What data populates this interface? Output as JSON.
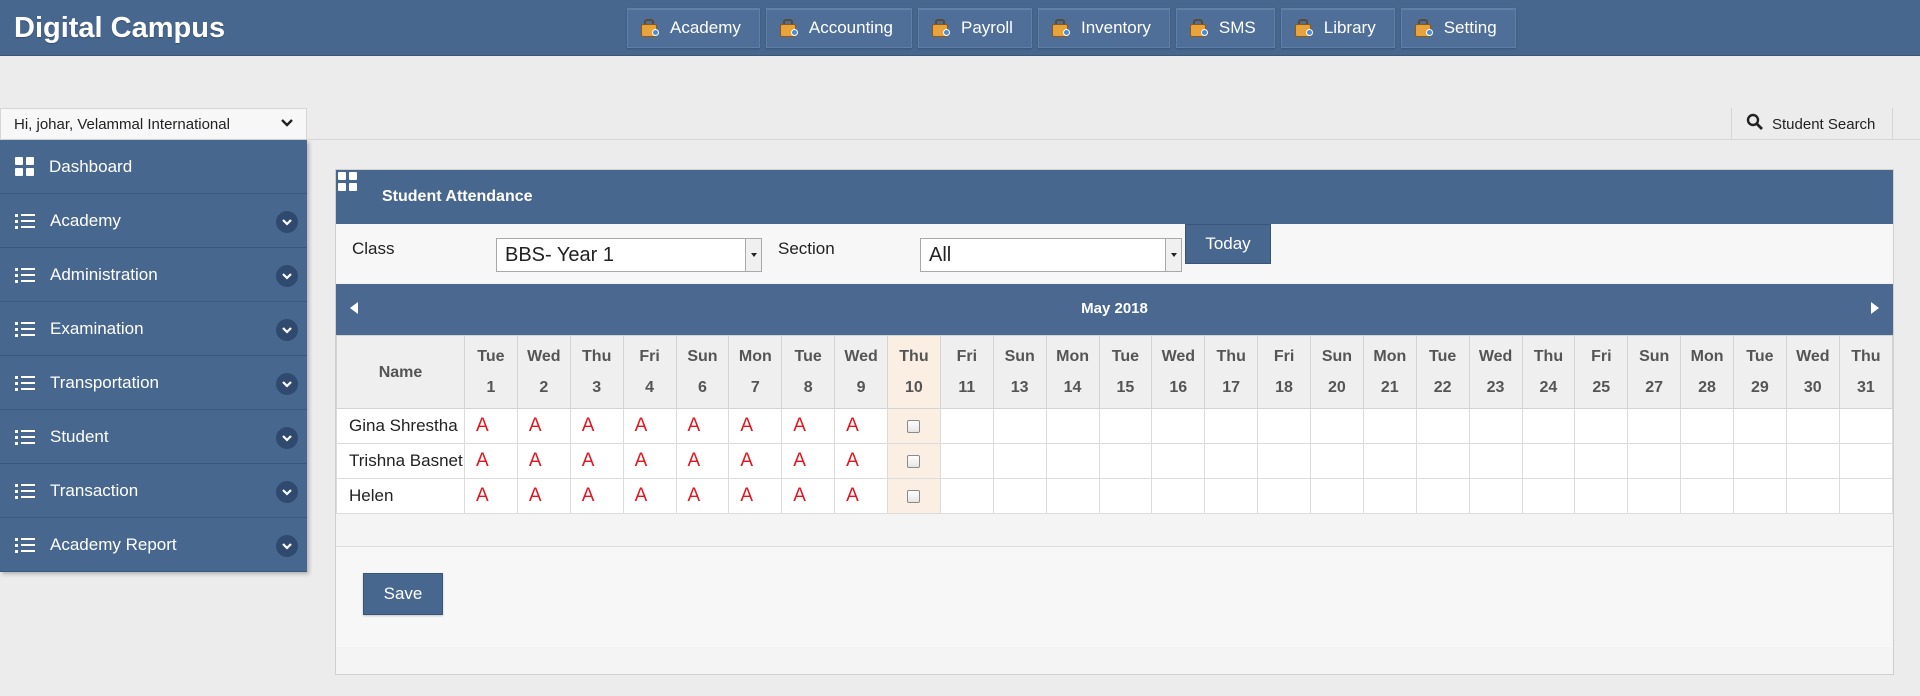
{
  "app": {
    "title": "Digital Campus"
  },
  "topnav": [
    "Academy",
    "Accounting",
    "Payroll",
    "Inventory",
    "SMS",
    "Library",
    "Setting"
  ],
  "user": {
    "greeting": "Hi, johar, Velammal International"
  },
  "sidebar": {
    "items": [
      {
        "label": "Dashboard",
        "icon": "dashboard-grid-icon"
      },
      {
        "label": "Academy",
        "icon": "list-icon"
      },
      {
        "label": "Administration",
        "icon": "list-icon"
      },
      {
        "label": "Examination",
        "icon": "list-icon"
      },
      {
        "label": "Transportation",
        "icon": "list-icon"
      },
      {
        "label": "Student",
        "icon": "list-icon"
      },
      {
        "label": "Transaction",
        "icon": "list-icon"
      },
      {
        "label": "Academy Report",
        "icon": "list-icon"
      }
    ]
  },
  "search": {
    "label": "Student Search"
  },
  "panel": {
    "title": "Student Attendance"
  },
  "filters": {
    "class_label": "Class",
    "class_value": "BBS- Year 1",
    "section_label": "Section",
    "section_value": "All",
    "today_label": "Today"
  },
  "calendar": {
    "month": "May 2018",
    "name_header": "Name",
    "days": [
      {
        "dow": "Tue",
        "day": "1"
      },
      {
        "dow": "Wed",
        "day": "2"
      },
      {
        "dow": "Thu",
        "day": "3"
      },
      {
        "dow": "Fri",
        "day": "4"
      },
      {
        "dow": "Sun",
        "day": "6"
      },
      {
        "dow": "Mon",
        "day": "7"
      },
      {
        "dow": "Tue",
        "day": "8"
      },
      {
        "dow": "Wed",
        "day": "9"
      },
      {
        "dow": "Thu",
        "day": "10"
      },
      {
        "dow": "Fri",
        "day": "11"
      },
      {
        "dow": "Sun",
        "day": "13"
      },
      {
        "dow": "Mon",
        "day": "14"
      },
      {
        "dow": "Tue",
        "day": "15"
      },
      {
        "dow": "Wed",
        "day": "16"
      },
      {
        "dow": "Thu",
        "day": "17"
      },
      {
        "dow": "Fri",
        "day": "18"
      },
      {
        "dow": "Sun",
        "day": "20"
      },
      {
        "dow": "Mon",
        "day": "21"
      },
      {
        "dow": "Tue",
        "day": "22"
      },
      {
        "dow": "Wed",
        "day": "23"
      },
      {
        "dow": "Thu",
        "day": "24"
      },
      {
        "dow": "Fri",
        "day": "25"
      },
      {
        "dow": "Sun",
        "day": "27"
      },
      {
        "dow": "Mon",
        "day": "28"
      },
      {
        "dow": "Tue",
        "day": "29"
      },
      {
        "dow": "Wed",
        "day": "30"
      },
      {
        "dow": "Thu",
        "day": "31"
      }
    ],
    "today_day": "10",
    "students": [
      {
        "name": "Gina Shrestha",
        "marks": [
          "A",
          "A",
          "A",
          "A",
          "A",
          "A",
          "A",
          "A"
        ]
      },
      {
        "name": "Trishna Basnet",
        "marks": [
          "A",
          "A",
          "A",
          "A",
          "A",
          "A",
          "A",
          "A"
        ]
      },
      {
        "name": "Helen",
        "marks": [
          "A",
          "A",
          "A",
          "A",
          "A",
          "A",
          "A",
          "A"
        ]
      }
    ]
  },
  "actions": {
    "save_label": "Save"
  },
  "colors": {
    "header": "#48678f",
    "absent": "#e3161f",
    "today_column": "#fbeee2"
  }
}
